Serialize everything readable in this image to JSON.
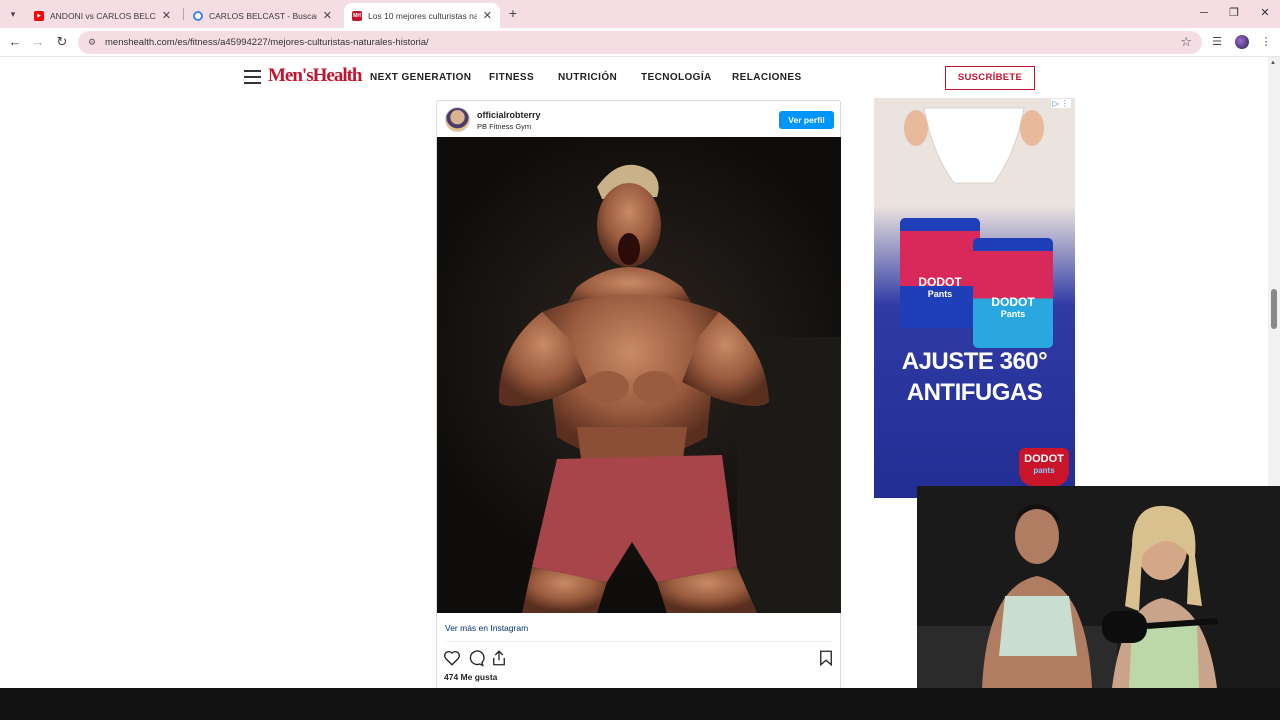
{
  "browser": {
    "tabs": [
      {
        "title": "ANDONI vs CARLOS BELCAST |",
        "favicon": "youtube-icon",
        "active": false
      },
      {
        "title": "CARLOS BELCAST - Buscar con",
        "favicon": "google-icon",
        "active": false
      },
      {
        "title": "Los 10 mejores culturistas natu",
        "favicon": "menshealth-icon",
        "active": true
      }
    ],
    "favicon_menshealth": "MH",
    "new_tab": "+",
    "url": "menshealth.com/es/fitness/a45994227/mejores-culturistas-naturales-historia/"
  },
  "site": {
    "logo": "Men'sHealth",
    "nav": [
      "NEXT GENERATION",
      "FITNESS",
      "NUTRICIÓN",
      "TECNOLOGÍA",
      "RELACIONES"
    ],
    "subscribe": "SUSCRÍBETE"
  },
  "instagram": {
    "username": "officialrobterry",
    "location": "PB Fitness Gym",
    "view_profile": "Ver perfil",
    "view_more": "Ver más en Instagram",
    "likes": "474 Me gusta"
  },
  "ad": {
    "headline_line1": "AJUSTE 360°",
    "headline_line2": "ANTIFUGAS",
    "brand": "DODOT",
    "product": "pants",
    "pack_label_1": "DODOT",
    "pack_sub_1": "Pants",
    "pack_label_2": "DODOT",
    "pack_sub_2": "Pants"
  },
  "colors": {
    "brand_red": "#c1152f",
    "instagram_blue": "#0095f6",
    "tab_strip": "#f5dde4"
  }
}
